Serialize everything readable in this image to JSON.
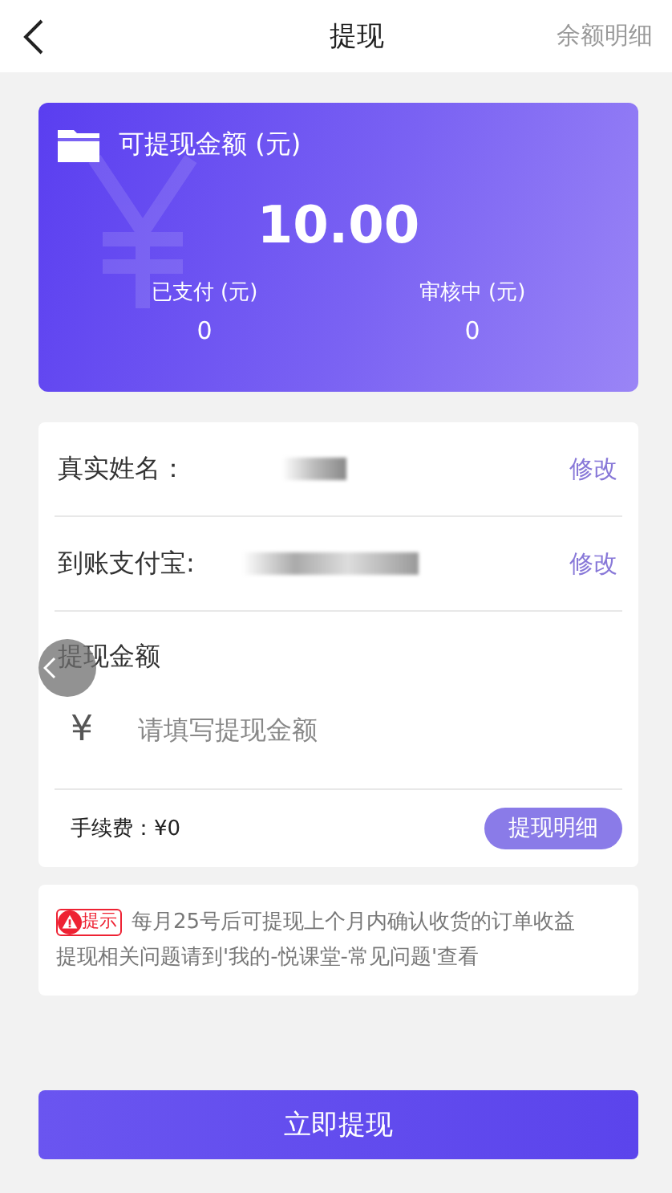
{
  "header": {
    "title": "提现",
    "action": "余额明细"
  },
  "balance_card": {
    "label": "可提现金额 (元)",
    "amount": "10.00",
    "stats": [
      {
        "label": "已支付 (元)",
        "value": "0"
      },
      {
        "label": "审核中 (元)",
        "value": "0"
      }
    ]
  },
  "form": {
    "rows": [
      {
        "label": "真实姓名：",
        "action": "修改"
      },
      {
        "label": "到账支付宝:",
        "action": "修改"
      }
    ],
    "amount_label": "提现金额",
    "currency": "¥",
    "amount_field": {
      "placeholder": "请填写提现金额"
    },
    "fee": "手续费：¥0",
    "details_button": "提现明细"
  },
  "notice": {
    "badge": "提示",
    "lines": [
      "每月25号后可提现上个月内确认收货的订单收益",
      "提现相关问题请到'我的-悦课堂-常见问题'查看"
    ]
  },
  "submit_button": "立即提现"
}
